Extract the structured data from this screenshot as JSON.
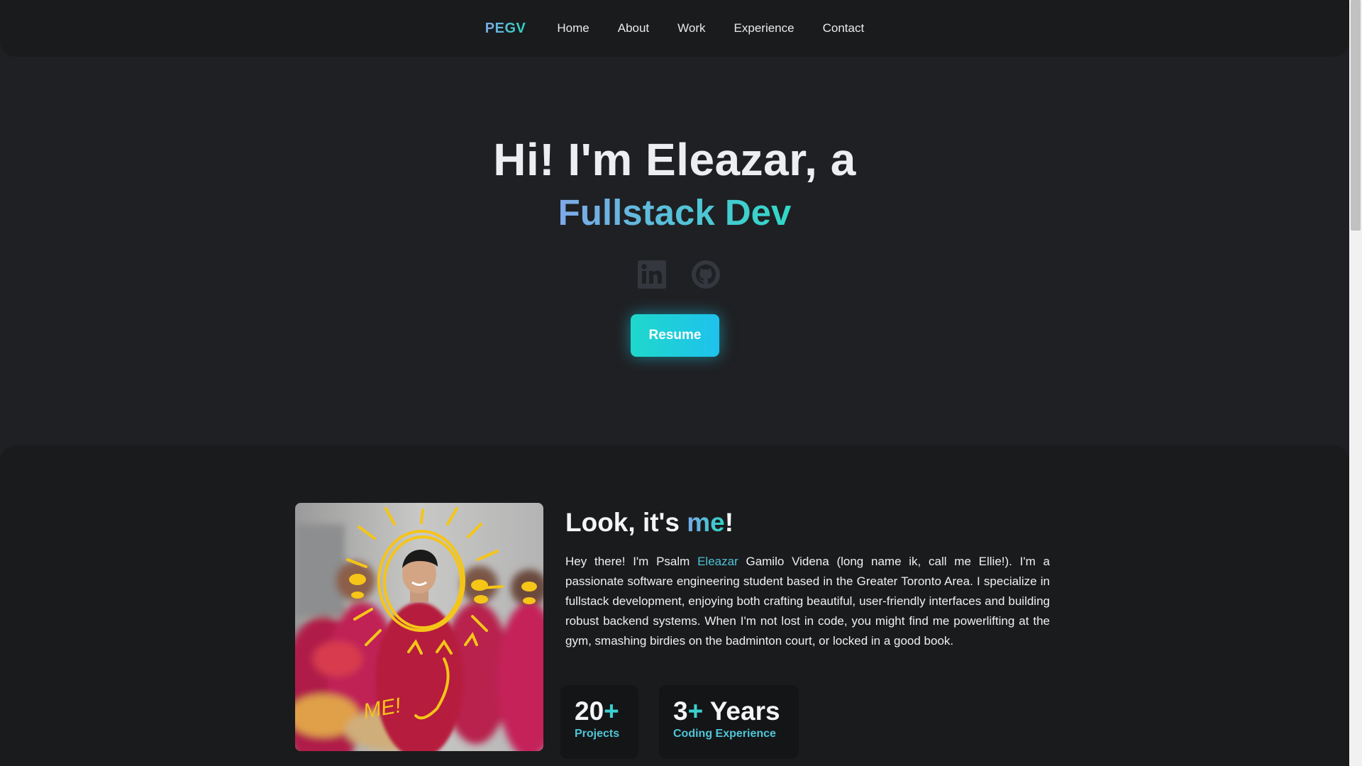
{
  "nav": {
    "logo": "PEGV",
    "links": [
      "Home",
      "About",
      "Work",
      "Experience",
      "Contact"
    ]
  },
  "hero": {
    "title": "Hi! I'm Eleazar, a",
    "subtitle": "Fullstack Dev",
    "social_icons": [
      "linkedin-icon",
      "github-icon"
    ],
    "resume_label": "Resume"
  },
  "about": {
    "title_prefix": "Look, it's ",
    "title_accent": "me",
    "title_suffix": "!",
    "intro_before": "Hey there! I'm Psalm ",
    "intro_name": "Eleazar",
    "intro_after": " Gamilo Videna (long name ik, call me Ellie!). I'm a passionate software engineering student based in the Greater Toronto Area. I specialize in fullstack development, enjoying both crafting beautiful, user-friendly interfaces and building robust backend systems. When I'm not lost in code, you might find me powerlifting at the gym, smashing birdies on the badminton court, or locked in a good book.",
    "photo_caption": "ME!",
    "stats": [
      {
        "number": "20",
        "plus": "+",
        "suffix": "",
        "label": "Projects"
      },
      {
        "number": "3",
        "plus": "+",
        "suffix": " Years",
        "label": "Coding Experience"
      }
    ]
  },
  "colors": {
    "background": "#1f2023",
    "accent_start": "#7aa8e8",
    "accent_end": "#2fd4c4",
    "button_gradient_start": "#1fd8cc",
    "button_gradient_end": "#1ec2ec"
  }
}
